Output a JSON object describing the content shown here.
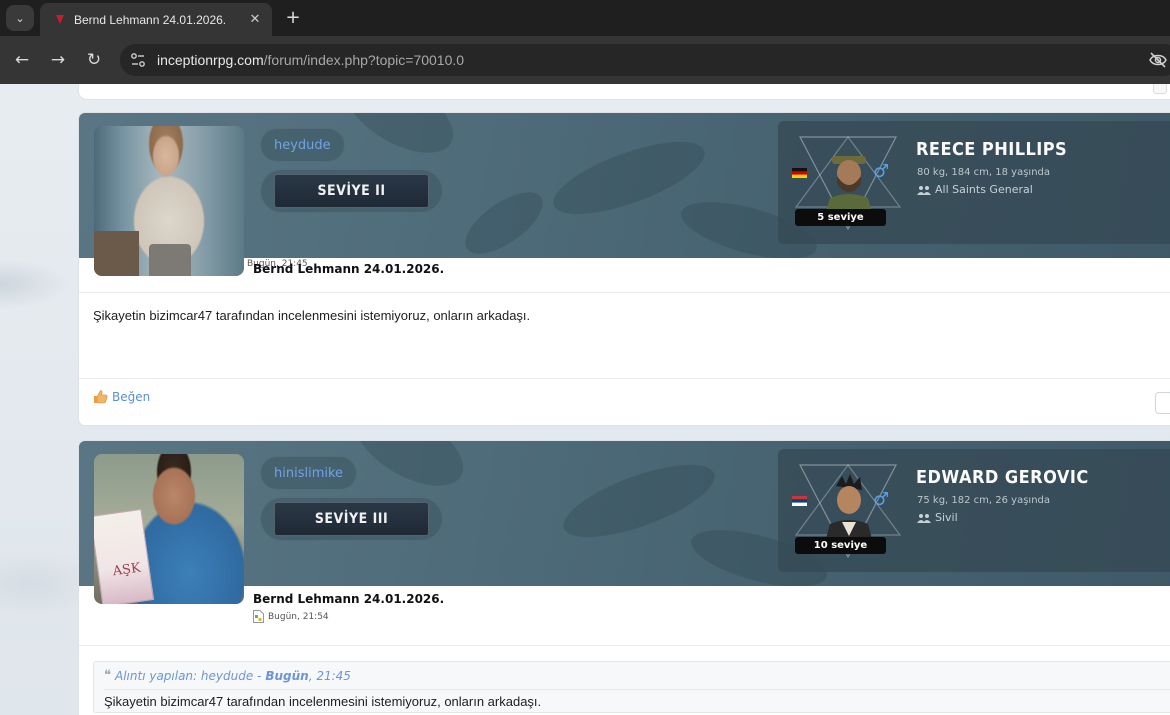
{
  "browser": {
    "tab_title": "Bernd Lehmann 24.01.2026.",
    "url_host": "inceptionrpg.com",
    "url_path": "/forum/index.php?topic=70010.0"
  },
  "posts": [
    {
      "username": "heydude",
      "level_label": "SEVİYE II",
      "character": {
        "name": "REECE PHILLIPS",
        "stats": "80 kg, 184 cm, 18 yaşında",
        "faction": "All Saints General",
        "level_tag": "5 seviye",
        "flag": "germany",
        "gender_symbol": "♂"
      },
      "title": "Bernd Lehmann 24.01.2026.",
      "date": "Bugün, 21:45",
      "body": "Şikayetin bizimcar47 tarafından incelenmesini istemiyoruz, onların arkadaşı.",
      "like_label": "Beğen"
    },
    {
      "username": "hinislimike",
      "level_label": "SEVİYE III",
      "character": {
        "name": "EDWARD GEROVIC",
        "stats": "75 kg, 182 cm, 26 yaşında",
        "faction": "Sivil",
        "level_tag": "10 seviye",
        "flag": "serbia",
        "gender_symbol": "♂"
      },
      "title": "Bernd Lehmann 24.01.2026.",
      "date": "Bugün, 21:54",
      "quote": {
        "prefix": "Alıntı yapılan: heydude -",
        "date_day": "Bugün",
        "date_time": ", 21:45",
        "body": "Şikayetin bizimcar47 tarafından incelenmesini istemiyoruz, onların arkadaşı."
      }
    }
  ],
  "colors": {
    "link": "#5b8fd8",
    "banner": "#4f6c7a",
    "chrome_bg": "#1f1f1f"
  }
}
